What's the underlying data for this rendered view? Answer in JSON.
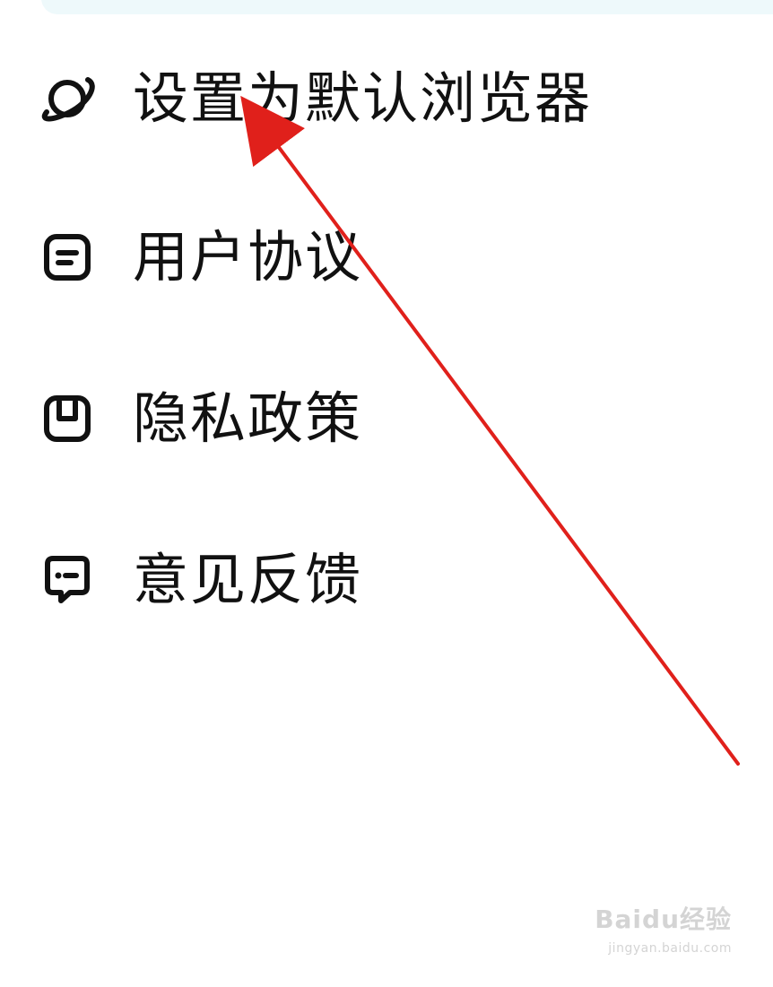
{
  "menu": {
    "items": [
      {
        "label": "设置为默认浏览器",
        "icon": "planet-icon"
      },
      {
        "label": "用户协议",
        "icon": "document-icon"
      },
      {
        "label": "隐私政策",
        "icon": "privacy-icon"
      },
      {
        "label": "意见反馈",
        "icon": "feedback-icon"
      }
    ]
  },
  "watermark": {
    "main": "Baidu经验",
    "sub": "jingyan.baidu.com"
  },
  "colors": {
    "text": "#111111",
    "top_card": "#eef9fb",
    "annotation_arrow": "#e0201b",
    "watermark": "#d4d4d4"
  }
}
